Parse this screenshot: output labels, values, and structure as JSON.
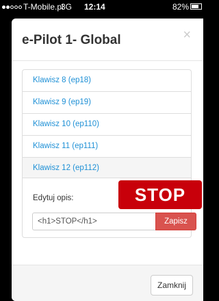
{
  "status_bar": {
    "carrier": "T-Mobile.pl",
    "network": "3G",
    "time": "12:14",
    "battery": "82%",
    "battery_level": 0.82
  },
  "modal": {
    "title": "e-Pilot 1- Global",
    "close_symbol": "×",
    "items": [
      {
        "label": "Klawisz 8 (ep18)"
      },
      {
        "label": "Klawisz 9 (ep19)"
      },
      {
        "label": "Klawisz 10 (ep110)"
      },
      {
        "label": "Klawisz 11 (ep111)"
      }
    ],
    "editor": {
      "item_label": "Klawisz 12 (ep112)",
      "description_label": "Edytuj opis:",
      "preview": "STOP",
      "input_value": "<h1>STOP</h1>",
      "save_label": "Zapisz"
    },
    "footer": {
      "close_label": "Zamknij"
    }
  },
  "colors": {
    "link": "#1e90d6",
    "stop_banner": "#c8000a",
    "save_button": "#d9534f"
  }
}
